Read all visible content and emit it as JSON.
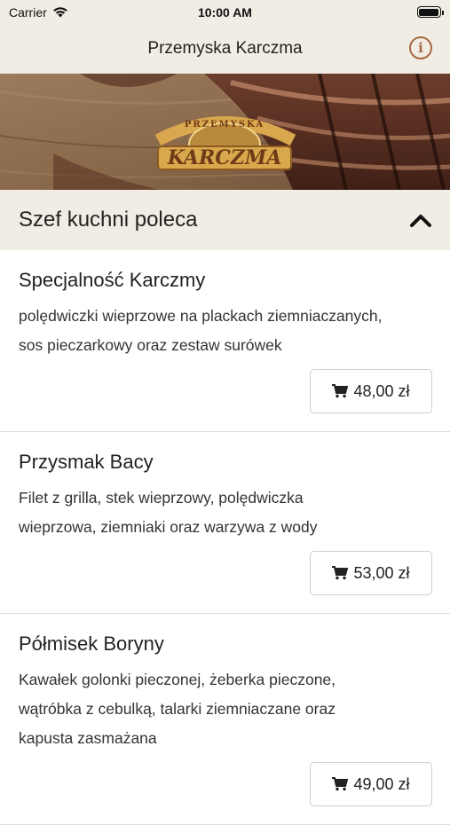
{
  "status": {
    "carrier": "Carrier",
    "time": "10:00 AM"
  },
  "nav": {
    "title": "Przemyska Karczma",
    "info_icon": "info-icon"
  },
  "banner": {
    "logo_text_top": "PRZEMYSKA",
    "logo_text_main": "KARCZMA"
  },
  "section": {
    "title": "Szef kuchni poleca",
    "icon": "chevron-up-icon"
  },
  "items": [
    {
      "name": "Specjalność Karczmy",
      "desc_lines": [
        "polędwiczki wieprzowe na plackach ziemniaczanych,",
        "sos pieczarkowy oraz zestaw surówek"
      ],
      "price": "48,00 zł"
    },
    {
      "name": "Przysmak Bacy",
      "desc_lines": [
        "Filet z grilla, stek wieprzowy, polędwiczka",
        "wieprzowa, ziemniaki oraz warzywa z wody"
      ],
      "price": "53,00 zł"
    },
    {
      "name": "Półmisek Boryny",
      "desc_lines": [
        "Kawałek golonki pieczonej, żeberka pieczone,",
        "wątróbka z cebulką, talarki ziemniaczane oraz",
        "kapusta zasmażana"
      ],
      "price": "49,00 zł"
    }
  ],
  "colors": {
    "header_bg": "#f1ede4",
    "accent": "#a5693d"
  }
}
